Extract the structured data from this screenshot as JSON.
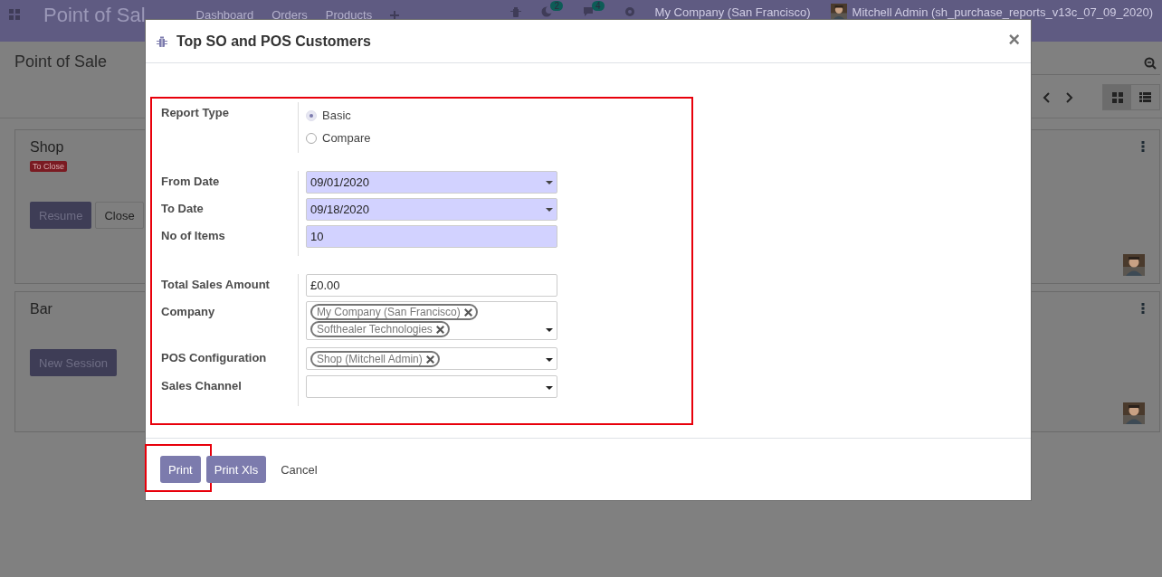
{
  "navbar": {
    "app_title": "Point of Sal",
    "menu": [
      "Dashboard",
      "Orders",
      "Products"
    ],
    "badges": [
      "2",
      "4"
    ],
    "company": "My Company (San Francisco)",
    "user": "Mitchell Admin (sh_purchase_reports_v13c_07_09_2020)"
  },
  "breadcrumb": "Point of Sale",
  "cards": [
    {
      "title": "Shop",
      "status": "To Close",
      "buttons": [
        {
          "label": "Resume",
          "kind": "primary"
        },
        {
          "label": "Close",
          "kind": "secondary"
        }
      ]
    },
    {
      "title": "Bar",
      "buttons": [
        {
          "label": "New Session",
          "kind": "primary"
        }
      ]
    }
  ],
  "dialog": {
    "title": "Top SO and POS Customers",
    "close": "×",
    "highlighted": true,
    "groups": [
      {
        "fields": [
          {
            "label": "Report Type",
            "kind": "radio",
            "options": [
              {
                "label": "Basic",
                "selected": true
              },
              {
                "label": "Compare",
                "selected": false
              }
            ]
          }
        ]
      },
      {
        "fields": [
          {
            "label": "From Date",
            "kind": "date",
            "value": "09/01/2020",
            "required": true
          },
          {
            "label": "To Date",
            "kind": "date",
            "value": "09/18/2020",
            "required": true
          },
          {
            "label": "No of Items",
            "kind": "text",
            "value": "10",
            "required": true
          }
        ]
      },
      {
        "fields": [
          {
            "label": "Total Sales Amount",
            "kind": "text",
            "value": "£0.00",
            "required": false
          },
          {
            "label": "Company",
            "kind": "tags",
            "tags": [
              "My Company (San Francisco)",
              "Softhealer Technologies"
            ]
          },
          {
            "label": "POS Configuration",
            "kind": "tags",
            "tags": [
              "Shop (Mitchell Admin)"
            ]
          },
          {
            "label": "Sales Channel",
            "kind": "select"
          }
        ]
      }
    ],
    "buttons": [
      {
        "label": "Print",
        "kind": "primary",
        "highlighted": true
      },
      {
        "label": "Print Xls",
        "kind": "primary",
        "highlighted": false
      },
      {
        "label": "Cancel",
        "kind": "link",
        "highlighted": false
      }
    ]
  }
}
